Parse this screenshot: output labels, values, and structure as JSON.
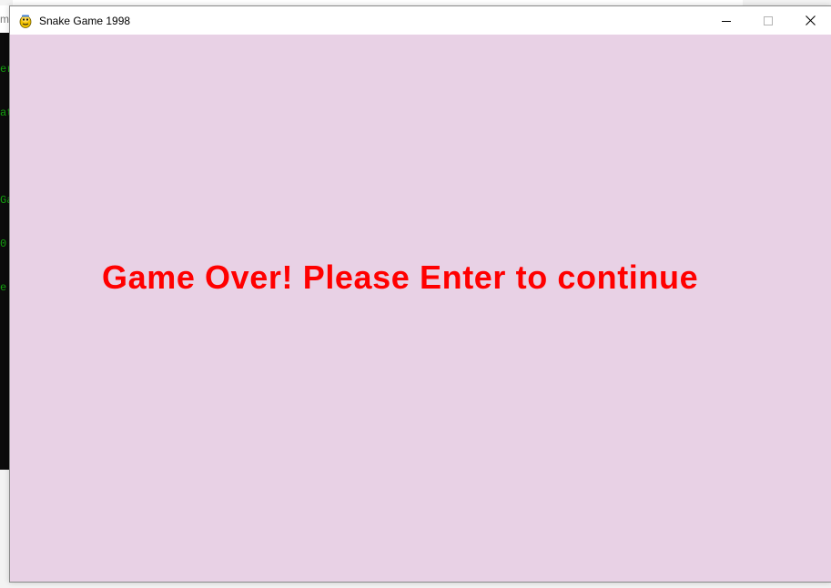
{
  "window": {
    "title": "Snake Game 1998",
    "icon": "pygame-snake-icon",
    "controls": {
      "minimize": "minimize-icon",
      "maximize": "maximize-icon",
      "close": "close-icon"
    }
  },
  "game": {
    "message": "Game Over! Please Enter to continue",
    "colors": {
      "background": "#e8d1e5",
      "message": "#ff0000"
    }
  },
  "background_terminal": {
    "title_fragment": "m",
    "lines": [
      "er",
      "at",
      "",
      "Ga",
      "0.",
      "e"
    ],
    "text_color": "#13a10e"
  }
}
